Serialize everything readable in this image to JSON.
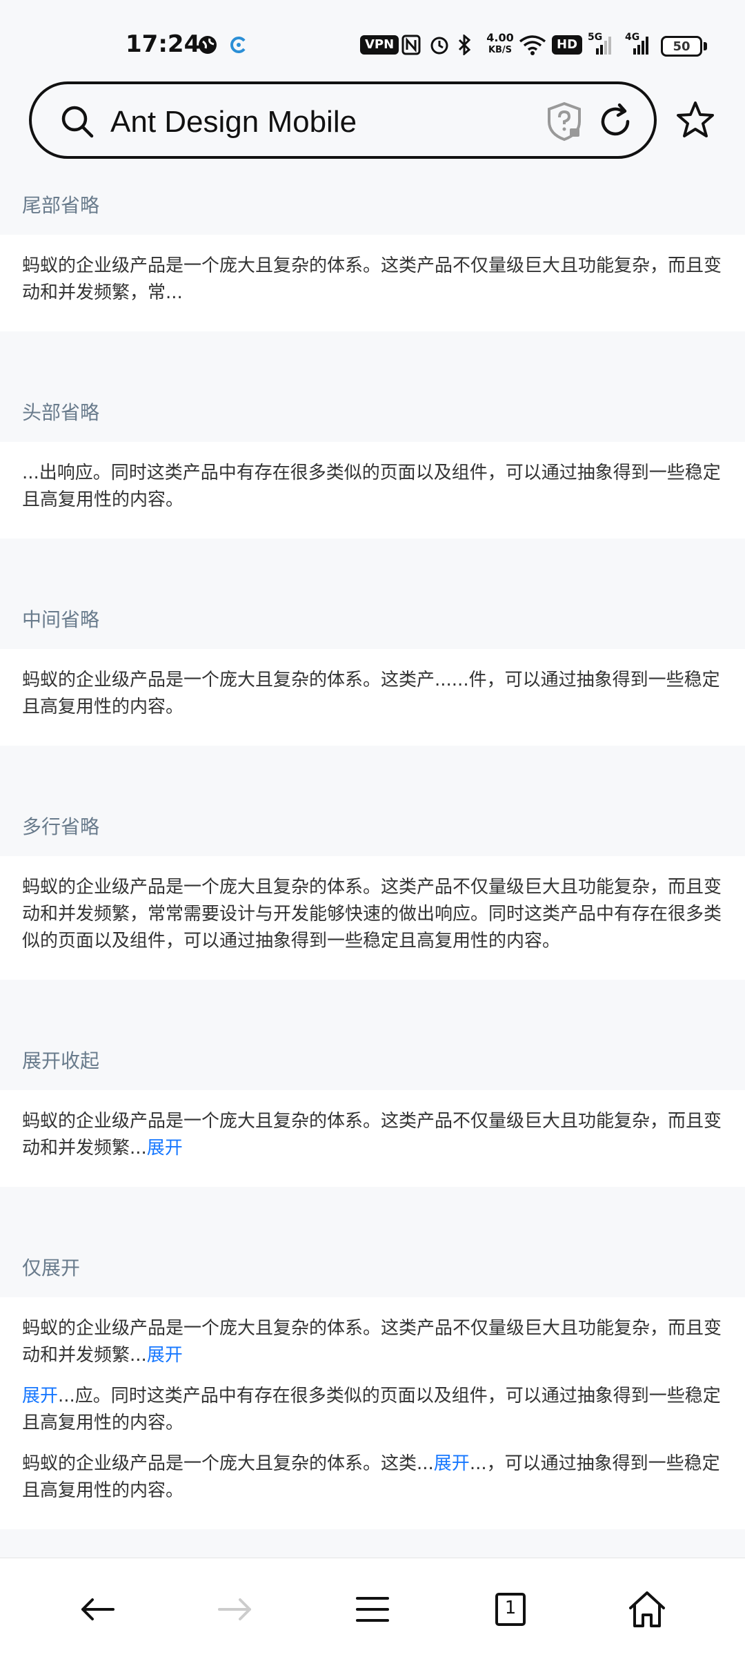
{
  "status_bar": {
    "time": "17:24",
    "vpn_label": "VPN",
    "net_speed_value": "4.00",
    "net_speed_unit": "KB/S",
    "hd_label": "HD",
    "signal1_label": "5G",
    "signal2_label": "4G",
    "battery_level": "50"
  },
  "browser": {
    "address_text": "Ant Design Mobile",
    "tab_count": "1"
  },
  "sections": [
    {
      "title": "尾部省略",
      "paragraphs": [
        {
          "parts": [
            {
              "text": "蚂蚁的企业级产品是一个庞大且复杂的体系。这类产品不仅量级巨大且功能复杂，而且变动和并发频繁，常..."
            }
          ]
        }
      ]
    },
    {
      "title": "头部省略",
      "paragraphs": [
        {
          "parts": [
            {
              "text": "...出响应。同时这类产品中有存在很多类似的页面以及组件，可以通过抽象得到一些稳定且高复用性的内容。"
            }
          ]
        }
      ]
    },
    {
      "title": "中间省略",
      "paragraphs": [
        {
          "parts": [
            {
              "text": "蚂蚁的企业级产品是一个庞大且复杂的体系。这类产......件，可以通过抽象得到一些稳定且高复用性的内容。"
            }
          ]
        }
      ]
    },
    {
      "title": "多行省略",
      "paragraphs": [
        {
          "parts": [
            {
              "text": "蚂蚁的企业级产品是一个庞大且复杂的体系。这类产品不仅量级巨大且功能复杂，而且变动和并发频繁，常常需要设计与开发能够快速的做出响应。同时这类产品中有存在很多类似的页面以及组件，可以通过抽象得到一些稳定且高复用性的内容。"
            }
          ]
        }
      ]
    },
    {
      "title": "展开收起",
      "paragraphs": [
        {
          "parts": [
            {
              "text": "蚂蚁的企业级产品是一个庞大且复杂的体系。这类产品不仅量级巨大且功能复杂，而且变动和并发频繁..."
            },
            {
              "text": "展开",
              "link": true
            }
          ]
        }
      ]
    },
    {
      "title": "仅展开",
      "paragraphs": [
        {
          "parts": [
            {
              "text": "蚂蚁的企业级产品是一个庞大且复杂的体系。这类产品不仅量级巨大且功能复杂，而且变动和并发频繁..."
            },
            {
              "text": "展开",
              "link": true
            }
          ]
        },
        {
          "parts": [
            {
              "text": "展开",
              "link": true
            },
            {
              "text": "...应。同时这类产品中有存在很多类似的页面以及组件，可以通过抽象得到一些稳定且高复用性的内容。"
            }
          ]
        },
        {
          "parts": [
            {
              "text": "蚂蚁的企业级产品是一个庞大且复杂的体系。这类..."
            },
            {
              "text": "展开",
              "link": true
            },
            {
              "text": "...，可以通过抽象得到一些稳定且高复用性的内容。"
            }
          ]
        }
      ]
    }
  ],
  "colors": {
    "link": "#1677ff",
    "section_title": "#697b8c",
    "background": "#f7f8fa"
  },
  "icons": {
    "search": "search-icon",
    "shield": "shield-question-icon",
    "reload": "reload-icon",
    "star": "star-icon",
    "back": "arrow-left-icon",
    "forward": "arrow-right-icon",
    "menu": "menu-icon",
    "tabs": "tabs-icon",
    "home": "home-icon"
  }
}
